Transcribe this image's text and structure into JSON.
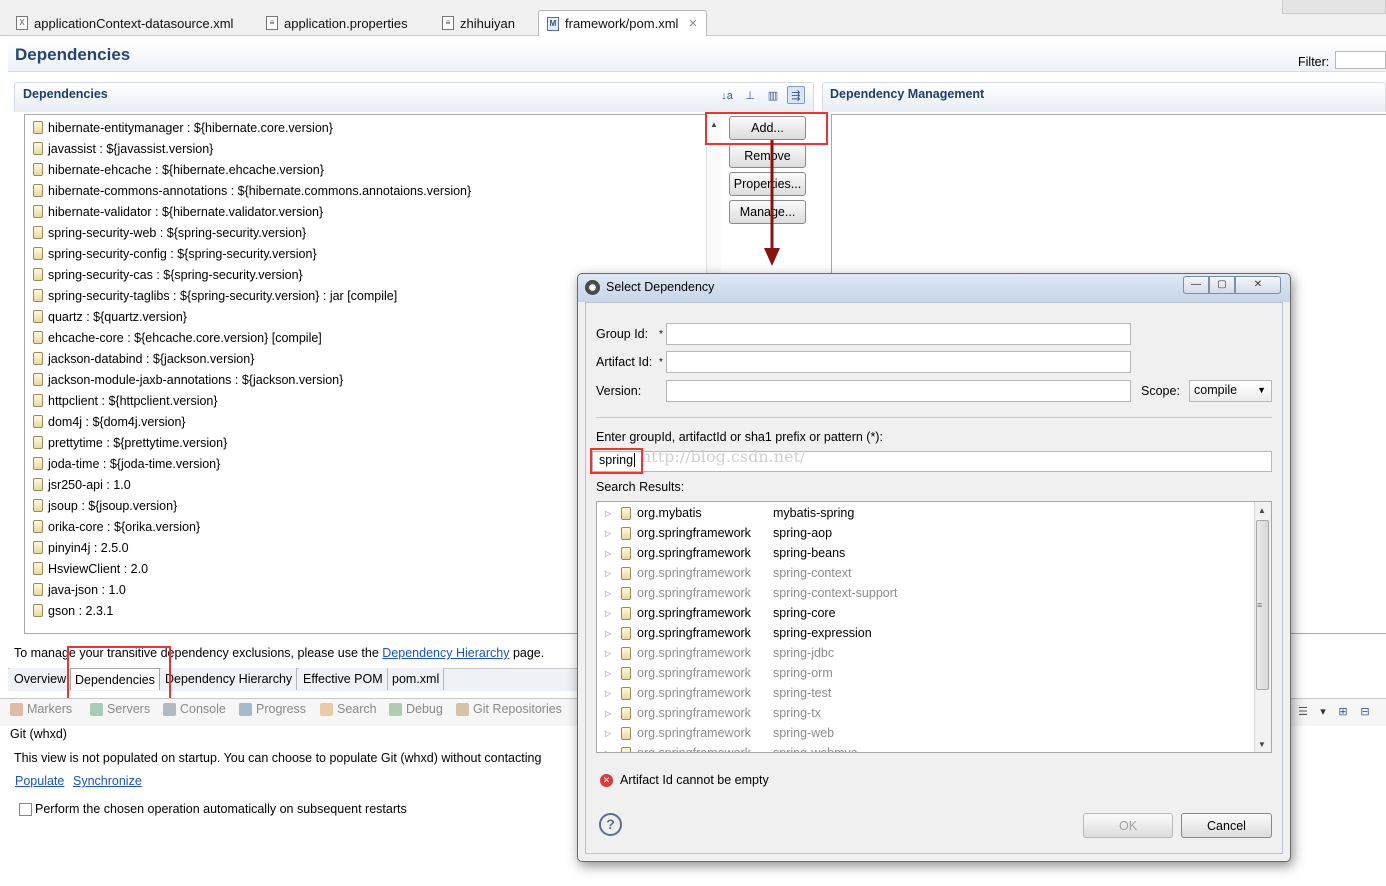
{
  "editor_tabs": [
    {
      "label": "applicationContext-datasource.xml",
      "icon": "X"
    },
    {
      "label": "application.properties",
      "icon": "≡"
    },
    {
      "label": "zhihuiyan",
      "icon": "≡"
    },
    {
      "label": "framework/pom.xml",
      "icon": "M"
    }
  ],
  "form": {
    "title": "Dependencies",
    "filter_label": "Filter:"
  },
  "dependencies": {
    "header": "Dependencies",
    "items": [
      "hibernate-entitymanager : ${hibernate.core.version}",
      "javassist : ${javassist.version}",
      "hibernate-ehcache : ${hibernate.ehcache.version}",
      "hibernate-commons-annotations : ${hibernate.commons.annotaions.version}",
      "hibernate-validator : ${hibernate.validator.version}",
      "spring-security-web : ${spring-security.version}",
      "spring-security-config : ${spring-security.version}",
      "spring-security-cas : ${spring-security.version}",
      "spring-security-taglibs : ${spring-security.version} : jar [compile]",
      "quartz : ${quartz.version}",
      "ehcache-core : ${ehcache.core.version} [compile]",
      "jackson-databind : ${jackson.version}",
      "jackson-module-jaxb-annotations : ${jackson.version}",
      "httpclient : ${httpclient.version}",
      "dom4j : ${dom4j.version}",
      "prettytime : ${prettytime.version}",
      "joda-time : ${joda-time.version}",
      "jsr250-api : 1.0",
      "jsoup : ${jsoup.version}",
      "orika-core : ${orika.version}",
      "pinyin4j : 2.5.0",
      "HsviewClient : 2.0",
      "java-json : 1.0",
      "gson : 2.3.1"
    ],
    "buttons": {
      "add": "Add...",
      "remove": "Remove",
      "properties": "Properties...",
      "manage": "Manage..."
    }
  },
  "dependency_management": {
    "header": "Dependency Management"
  },
  "hint": {
    "prefix": "To manage your transitive dependency exclusions, please use the",
    "link": "Dependency Hierarchy",
    "suffix": "page."
  },
  "bottom_tabs": [
    "Overview",
    "Dependencies",
    "Dependency Hierarchy",
    "Effective POM",
    "pom.xml"
  ],
  "views": [
    "Markers",
    "Servers",
    "Console",
    "Progress",
    "Search",
    "Debug",
    "Git Repositories"
  ],
  "git": {
    "title": "Git (whxd)",
    "message": "This view is not populated on startup. You can choose to populate Git (whxd) without contacting",
    "populate": "Populate",
    "synchronize": "Synchronize",
    "checkbox_label": "Perform the chosen operation automatically on subsequent restarts"
  },
  "dialog": {
    "title": "Select Dependency",
    "group_id_label": "Group Id:",
    "artifact_id_label": "Artifact Id:",
    "version_label": "Version:",
    "required_mark": "*",
    "scope_label": "Scope:",
    "scope_value": "compile",
    "search_label": "Enter groupId, artifactId or sha1 prefix or pattern (*):",
    "search_value": "spring",
    "watermark": "http://blog.csdn.net/",
    "results_label": "Search Results:",
    "results": [
      {
        "group": "org.mybatis",
        "artifact": "mybatis-spring",
        "gray": false
      },
      {
        "group": "org.springframework",
        "artifact": "spring-aop",
        "gray": false
      },
      {
        "group": "org.springframework",
        "artifact": "spring-beans",
        "gray": false
      },
      {
        "group": "org.springframework",
        "artifact": "spring-context",
        "gray": true
      },
      {
        "group": "org.springframework",
        "artifact": "spring-context-support",
        "gray": true
      },
      {
        "group": "org.springframework",
        "artifact": "spring-core",
        "gray": false
      },
      {
        "group": "org.springframework",
        "artifact": "spring-expression",
        "gray": false
      },
      {
        "group": "org.springframework",
        "artifact": "spring-jdbc",
        "gray": true
      },
      {
        "group": "org.springframework",
        "artifact": "spring-orm",
        "gray": true
      },
      {
        "group": "org.springframework",
        "artifact": "spring-test",
        "gray": true
      },
      {
        "group": "org.springframework",
        "artifact": "spring-tx",
        "gray": true
      },
      {
        "group": "org.springframework",
        "artifact": "spring-web",
        "gray": true
      },
      {
        "group": "org.springframework",
        "artifact": "spring-webmvc",
        "gray": true
      }
    ],
    "error": "Artifact Id cannot be empty",
    "ok": "OK",
    "cancel": "Cancel"
  },
  "colors": {
    "accent": "#1c3e6e",
    "highlight": "#e33333",
    "arrow": "#8b1010",
    "link": "#1a56b8"
  }
}
